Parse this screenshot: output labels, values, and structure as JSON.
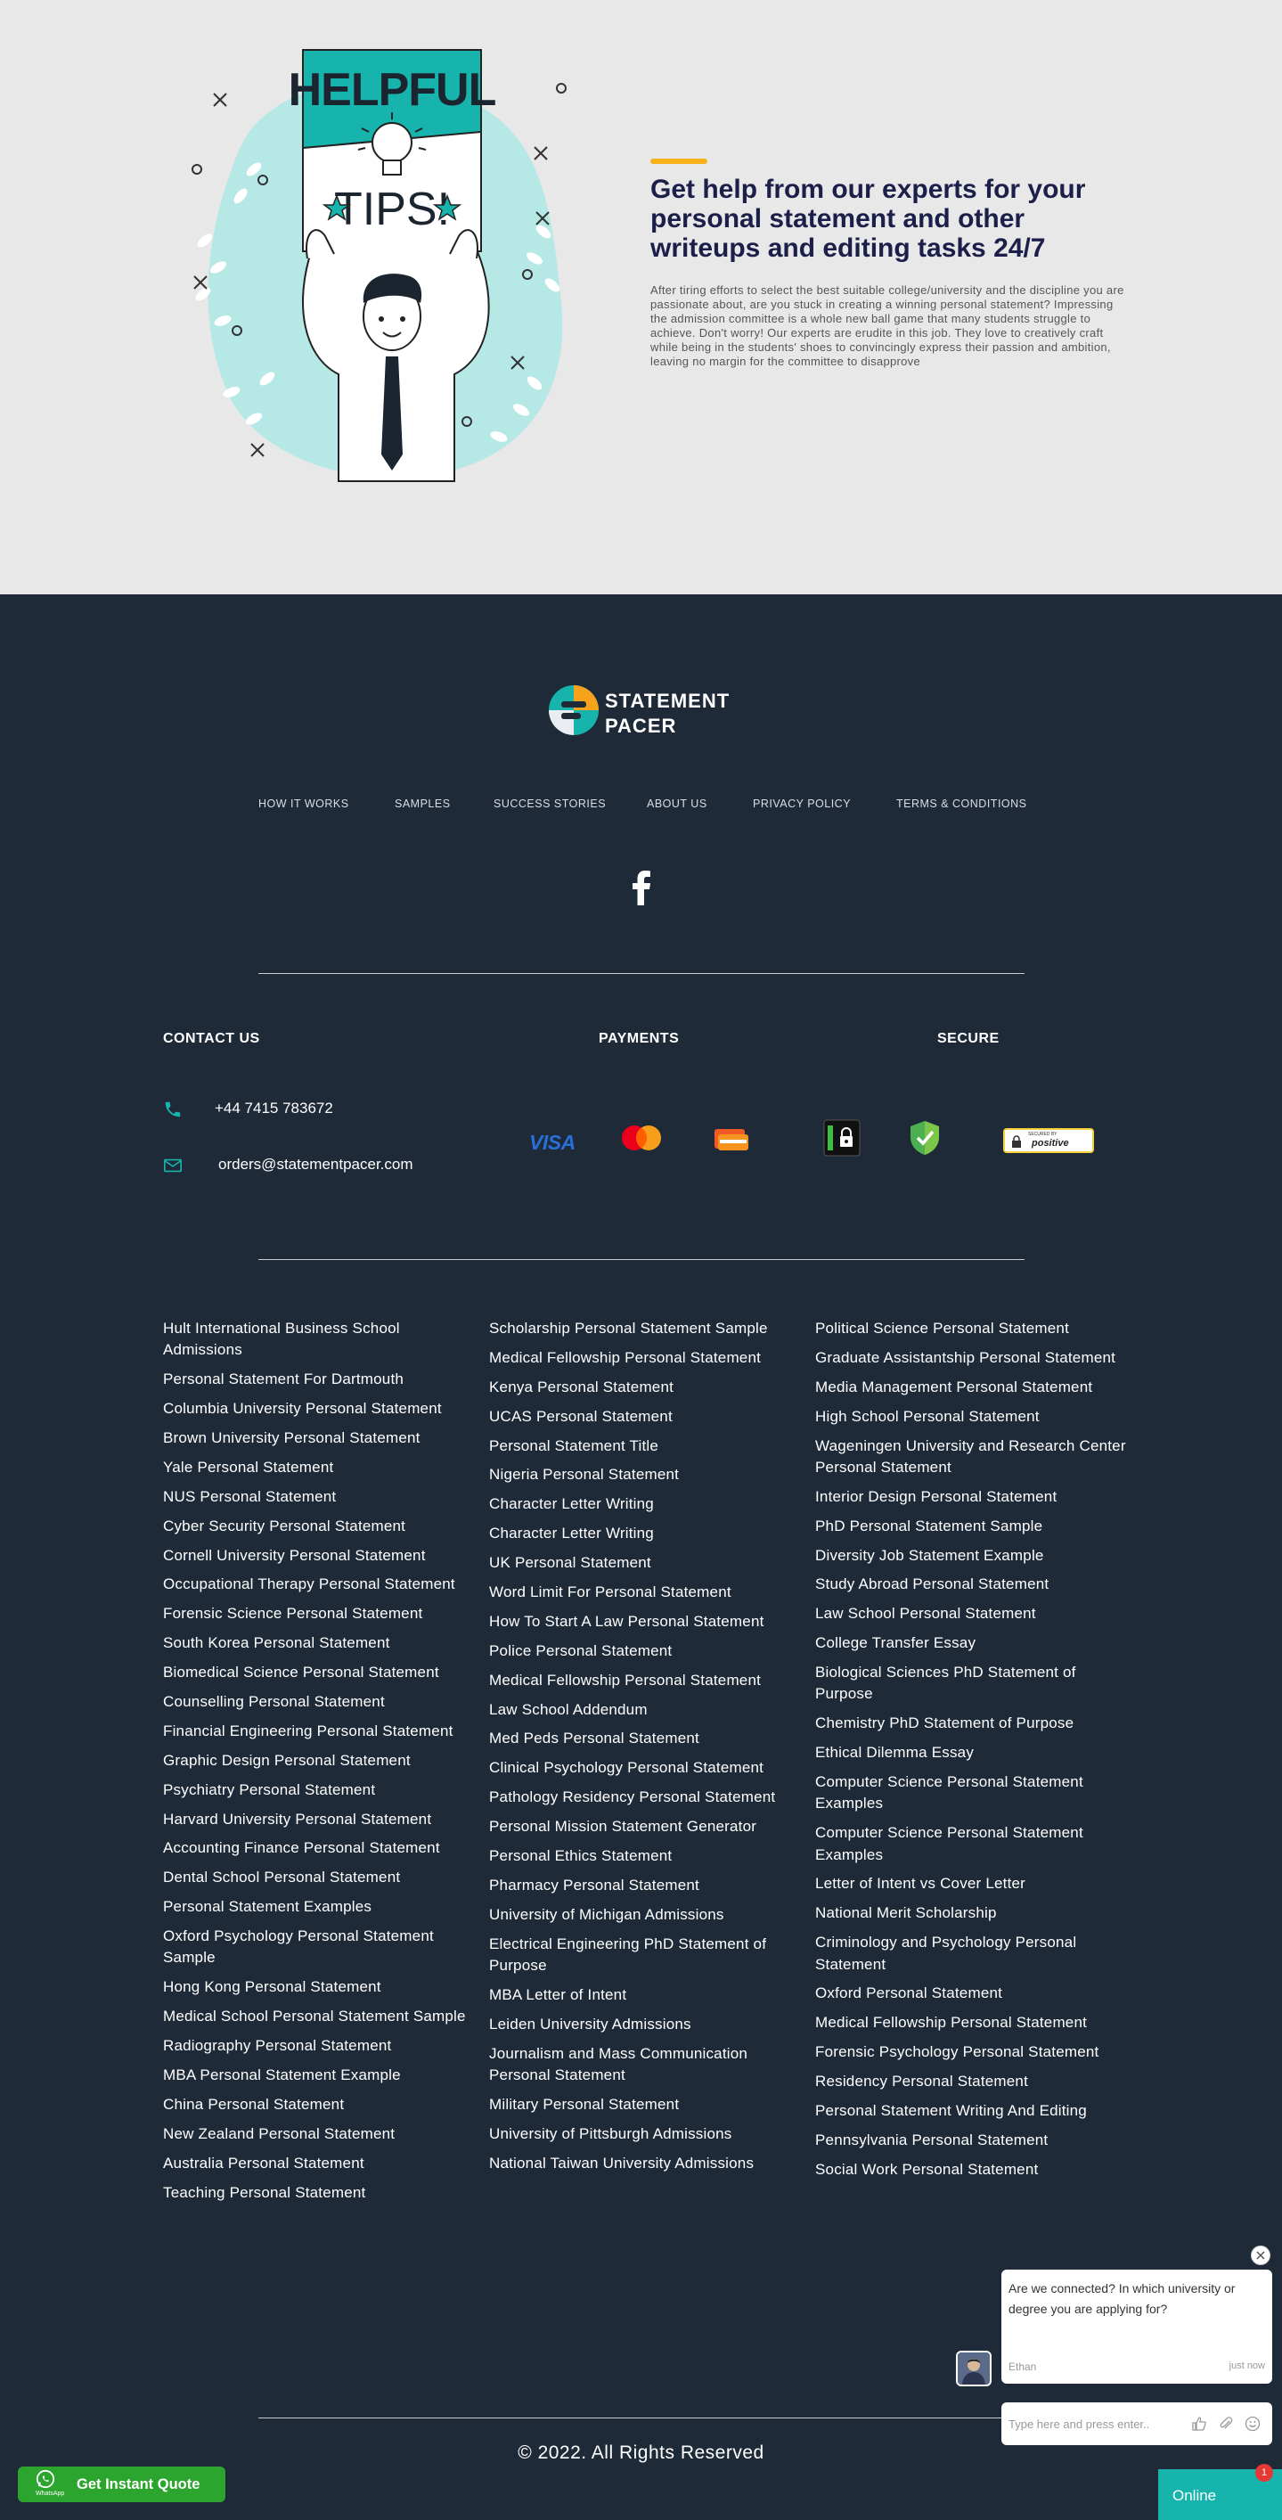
{
  "hero": {
    "title": "Get help from our experts for your personal statement and other writeups and editing tasks 24/7",
    "body": "After tiring efforts to select the best suitable college/university and the discipline you are passionate about, are you stuck in creating a winning personal statement? Impressing the admission committee is a whole new ball game that many students struggle to achieve. Don't worry! Our experts are erudite in this job. They love to creatively craft while being in the students' shoes to convincingly express their passion and ambition, leaving no margin for the committee to disapprove",
    "illustration": {
      "top_text": "HELPFUL",
      "bottom_text": "TIPS!"
    },
    "accent_color": "#f7b21b"
  },
  "brand": {
    "line1": "STATEMENT",
    "line2": "PACER"
  },
  "nav": [
    "HOW IT WORKS",
    "SAMPLES",
    "SUCCESS STORIES",
    "ABOUT US",
    "PRIVACY POLICY",
    "TERMS & CONDITIONS"
  ],
  "contact": {
    "heading": "CONTACT US",
    "phone": "+44 7415 783672",
    "email": "orders@statementpacer.com"
  },
  "payments": {
    "heading": "PAYMENTS",
    "visa": "VISA"
  },
  "secure": {
    "heading": "SECURE",
    "badge_top": "SECURED BY",
    "badge_text": "positive"
  },
  "links": {
    "col1": [
      "Hult International Business School Admissions",
      "Personal Statement For Dartmouth",
      "Columbia University Personal Statement",
      "Brown University Personal Statement",
      "Yale Personal Statement",
      "NUS Personal Statement",
      "Cyber Security Personal Statement",
      "Cornell University Personal Statement",
      "Occupational Therapy Personal Statement",
      "Forensic Science Personal Statement",
      "South Korea Personal Statement",
      "Biomedical Science Personal Statement",
      "Counselling Personal Statement",
      "Financial Engineering Personal Statement",
      "Graphic Design Personal Statement",
      "Psychiatry Personal Statement",
      "Harvard University Personal Statement",
      "Accounting Finance Personal Statement",
      "Dental School Personal Statement",
      "Personal Statement Examples",
      "Oxford Psychology Personal Statement Sample",
      "Hong Kong Personal Statement",
      "Medical School Personal Statement Sample",
      "Radiography Personal Statement",
      "MBA Personal Statement Example",
      "China Personal Statement",
      "New Zealand Personal Statement",
      "Australia Personal Statement",
      "Teaching Personal Statement"
    ],
    "col2": [
      "Scholarship Personal Statement Sample",
      "Medical Fellowship Personal Statement",
      "Kenya Personal Statement",
      "UCAS Personal Statement",
      "Personal Statement Title",
      "Nigeria Personal Statement",
      "Character Letter Writing",
      "Character Letter Writing",
      "UK Personal Statement",
      "Word Limit For Personal Statement",
      "How To Start A Law Personal Statement",
      "Police Personal Statement",
      "Medical Fellowship Personal Statement",
      "Law School Addendum",
      "Med Peds Personal Statement",
      "Clinical Psychology Personal Statement",
      "Pathology Residency Personal Statement",
      "Personal Mission Statement Generator",
      "Personal Ethics Statement",
      "Pharmacy Personal Statement",
      "University of Michigan Admissions",
      "Electrical Engineering PhD Statement of Purpose",
      "MBA Letter of Intent",
      "Leiden University Admissions",
      "Journalism and Mass Communication Personal Statement",
      "Military Personal Statement",
      "University of Pittsburgh Admissions",
      "National Taiwan University Admissions"
    ],
    "col3": [
      "Political Science Personal Statement",
      "Graduate Assistantship Personal Statement",
      "Media Management Personal Statement",
      "High School Personal Statement",
      "Wageningen University and Research Center Personal Statement",
      "Interior Design Personal Statement",
      "PhD Personal Statement Sample",
      "Diversity Job Statement Example",
      "Study Abroad Personal Statement",
      "Law School Personal Statement",
      "College Transfer Essay",
      "Biological Sciences PhD Statement of Purpose",
      "Chemistry PhD Statement of Purpose",
      "Ethical Dilemma Essay",
      "Computer Science Personal Statement Examples",
      "Computer Science Personal Statement Examples",
      "Letter of Intent vs Cover Letter",
      "National Merit Scholarship",
      "Criminology and Psychology Personal Statement",
      "Oxford Personal Statement",
      "Medical Fellowship Personal Statement",
      "Forensic Psychology Personal Statement",
      "Residency Personal Statement",
      "Personal Statement Writing And Editing",
      "Pennsylvania Personal Statement",
      "Social Work Personal Statement"
    ]
  },
  "copyright": "© 2022. All Rights Reserved",
  "quote_button": {
    "label": "Get Instant Quote",
    "sub": "WhatsApp"
  },
  "chat": {
    "message": "Are we connected? In which university or degree you are applying for?",
    "agent": "Ethan",
    "time": "just now",
    "input_placeholder": "Type here and press enter..",
    "status": "Online",
    "unread": "1"
  },
  "colors": {
    "footer_bg": "#1f2a38",
    "hero_bg": "#e8e8e8",
    "teal": "#17b3ad",
    "whatsapp_green": "#2ba52d"
  },
  "icons": [
    "facebook-icon",
    "phone-icon",
    "mail-icon",
    "close-icon",
    "thumbs-up-icon",
    "paperclip-icon",
    "emoji-icon",
    "whatsapp-icon"
  ]
}
